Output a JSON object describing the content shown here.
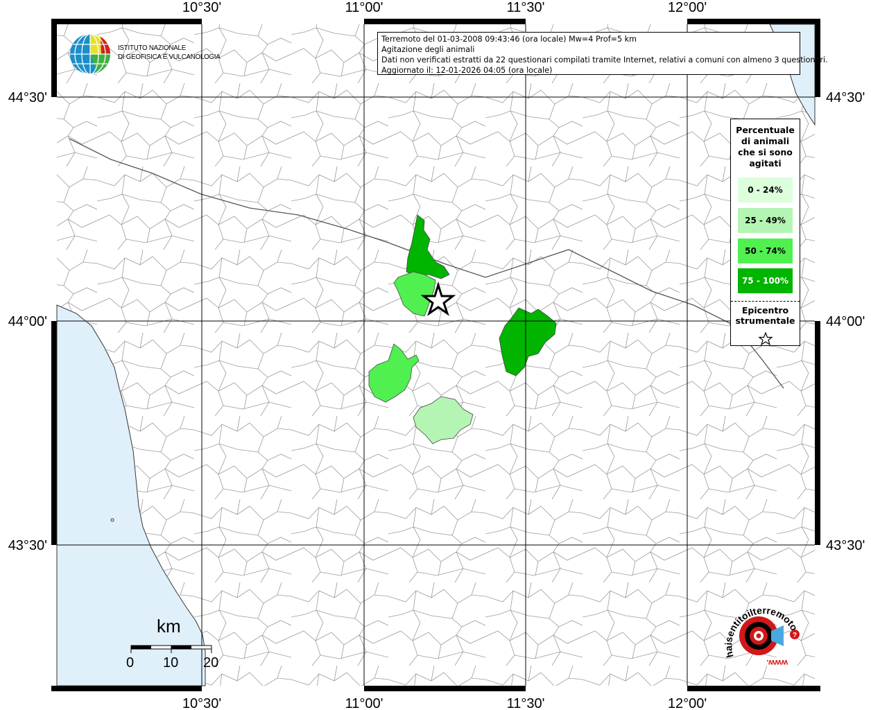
{
  "map": {
    "lon_labels": [
      "10°30'",
      "11°00'",
      "11°30'",
      "12°00'"
    ],
    "lat_labels": [
      "44°30'",
      "44°00'",
      "43°30'"
    ]
  },
  "info": {
    "line1": "Terremoto del 01-03-2008 09:43:46 (ora locale) Mw=4 Prof=5 km",
    "line2": "Agitazione degli animali",
    "line3": "Dati non verificati estratti da 22 questionari compilati tramite Internet, relativi a comuni con almeno 3 questionari.",
    "line4": "Aggiornato il: 12-01-2026 04:05 (ora locale)"
  },
  "legend": {
    "title_lines": [
      "Percentuale",
      "di animali",
      "che si sono",
      "agitati"
    ],
    "classes": [
      {
        "label": "0 - 24%",
        "color": "#dcffdc"
      },
      {
        "label": "25 - 49%",
        "color": "#b4f5b4"
      },
      {
        "label": "50 - 74%",
        "color": "#50f050"
      },
      {
        "label": "75 - 100%",
        "color": "#00b400"
      }
    ],
    "epicenter_lines": [
      "Epicentro",
      "strumentale"
    ]
  },
  "logo": {
    "line1": "ISTITUTO NAZIONALE",
    "line2": "DI GEOFISICA E VULCANOLOGIA"
  },
  "scale": {
    "unit": "km",
    "ticks": [
      "0",
      "10",
      "20"
    ]
  },
  "hsn_logo": {
    "text": "haisentitoilterremoto.it",
    "www": "www."
  },
  "colors": {
    "sea": "#e0f0fa",
    "grid": "#000000",
    "boundaries": "#9a9a9a"
  }
}
